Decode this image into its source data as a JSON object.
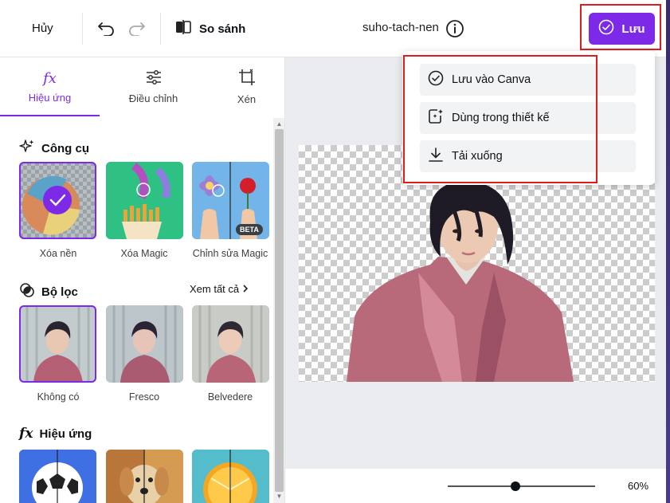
{
  "topbar": {
    "cancel_label": "Hủy",
    "compare_label": "So sánh",
    "filename": "suho-tach-nen",
    "save_label": "Lưu"
  },
  "tabs": [
    {
      "label": "Hiệu ứng",
      "icon": "fx-icon",
      "active": true
    },
    {
      "label": "Điều chỉnh",
      "icon": "sliders-icon",
      "active": false
    },
    {
      "label": "Xén",
      "icon": "crop-icon",
      "active": false
    }
  ],
  "tools": {
    "title": "Công cụ",
    "items": [
      {
        "label": "Xóa nền",
        "selected": true
      },
      {
        "label": "Xóa Magic",
        "selected": false
      },
      {
        "label": "Chỉnh sửa Magic",
        "badge": "BETA",
        "selected": false
      }
    ]
  },
  "filters": {
    "title": "Bộ lọc",
    "see_all": "Xem tất cả",
    "items": [
      {
        "label": "Không có",
        "selected": true
      },
      {
        "label": "Fresco",
        "selected": false
      },
      {
        "label": "Belvedere",
        "selected": false
      }
    ]
  },
  "effects": {
    "title": "Hiệu ứng"
  },
  "save_menu": {
    "items": [
      {
        "label": "Lưu vào Canva",
        "icon": "check-circle-icon"
      },
      {
        "label": "Dùng trong thiết kế",
        "icon": "add-to-design-icon"
      },
      {
        "label": "Tải xuống",
        "icon": "download-icon"
      }
    ]
  },
  "zoom": {
    "value": "60%",
    "level": 0.46
  },
  "colors": {
    "accent": "#7d2ae8",
    "highlight": "#e01d1d"
  }
}
